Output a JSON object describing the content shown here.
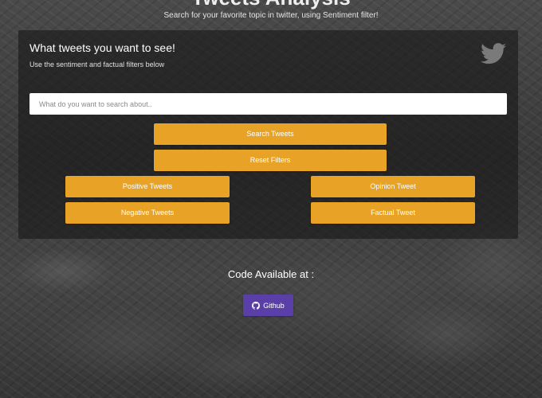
{
  "header": {
    "title": "Tweets Analysis",
    "subtitle": "Search for your favorite topic in twitter, using Sentiment filter!"
  },
  "panel": {
    "heading": "What tweets you want to see!",
    "description": "Use the sentiment and factual filters below",
    "icon": "twitter-icon",
    "search": {
      "placeholder": "What do you want to search about..",
      "value": ""
    },
    "buttons": {
      "search": "Search Tweets",
      "reset": "Reset Filters",
      "positive": "Positive Tweets",
      "opinion": "Opinion Tweet",
      "negative": "Negative Tweets",
      "factual": "Factual Tweet"
    }
  },
  "footer": {
    "code_label": "Code Available at :",
    "github_label": "Github",
    "github_icon": "github-icon"
  },
  "colors": {
    "accent": "#e8a326",
    "github": "#5a3fa8",
    "panel": "#181818"
  }
}
